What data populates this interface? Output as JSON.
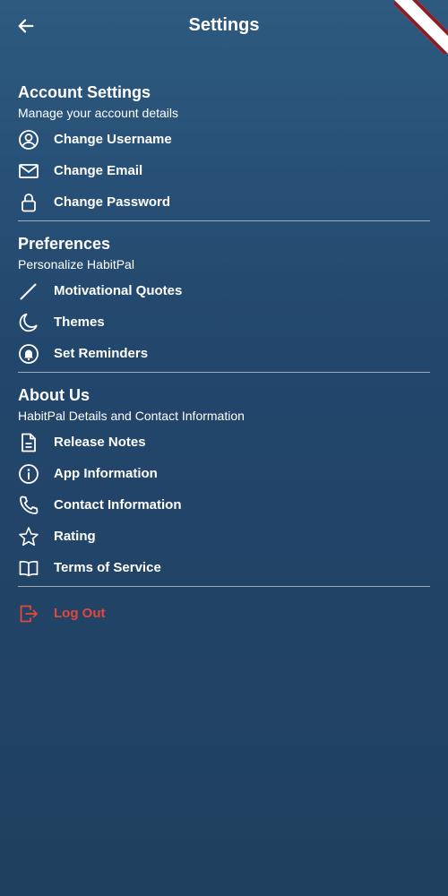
{
  "appbar": {
    "title": "Settings"
  },
  "sections": [
    {
      "title": "Account Settings",
      "subtitle": "Manage your account details",
      "items": [
        {
          "label": "Change Username",
          "icon": "account-circle-icon"
        },
        {
          "label": "Change Email",
          "icon": "mail-icon"
        },
        {
          "label": "Change Password",
          "icon": "lock-icon"
        }
      ]
    },
    {
      "title": "Preferences",
      "subtitle": "Personalize HabitPal",
      "items": [
        {
          "label": "Motivational Quotes",
          "icon": "pencil-icon"
        },
        {
          "label": "Themes",
          "icon": "moon-icon"
        },
        {
          "label": "Set Reminders",
          "icon": "bell-icon"
        }
      ]
    },
    {
      "title": "About Us",
      "subtitle": "HabitPal Details and Contact Information",
      "items": [
        {
          "label": "Release Notes",
          "icon": "document-icon"
        },
        {
          "label": "App Information",
          "icon": "info-icon"
        },
        {
          "label": "Contact Information",
          "icon": "phone-icon"
        },
        {
          "label": "Rating",
          "icon": "star-icon"
        },
        {
          "label": "Terms of Service",
          "icon": "book-icon"
        }
      ]
    }
  ],
  "logout": {
    "label": "Log Out",
    "icon": "logout-icon",
    "color": "#e5483a"
  },
  "colors": {
    "background_top": "#2e5a80",
    "background_bottom": "#20405f",
    "text": "#ffffff",
    "danger": "#e5483a"
  }
}
